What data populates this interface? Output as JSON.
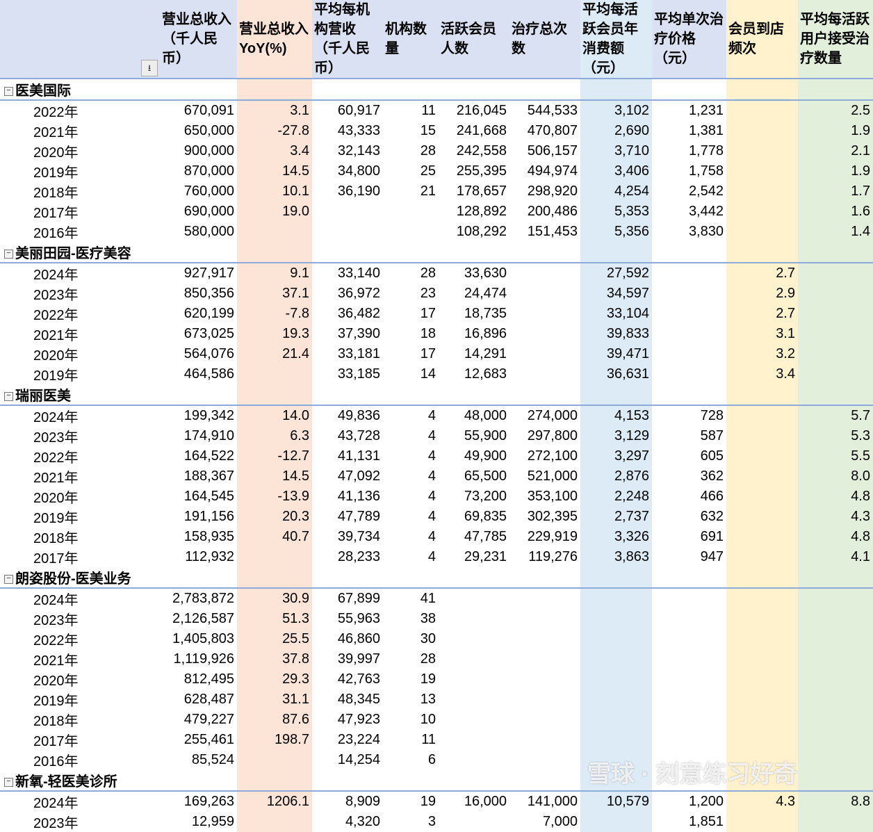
{
  "headers": [
    "",
    "营业总收入（千人民币）",
    "营业总收入YoY(%)",
    "平均每机构营收（千人民币）",
    "机构数量",
    "活跃会员人数",
    "治疗总次数",
    "平均每活跃会员年消费额（元）",
    "平均单次治疗价格（元）",
    "会员到店频次",
    "平均每活跃用户接受治疗数量"
  ],
  "filter_icon": "sort-filter-icon",
  "collapse_symbol": "−",
  "watermark": "雪球 · 刻意练习好奇",
  "groups": [
    {
      "name": "医美国际",
      "rows": [
        [
          "2022年",
          "670,091",
          "3.1",
          "60,917",
          "11",
          "216,045",
          "544,533",
          "3,102",
          "1,231",
          "",
          "2.5"
        ],
        [
          "2021年",
          "650,000",
          "-27.8",
          "43,333",
          "15",
          "241,668",
          "470,807",
          "2,690",
          "1,381",
          "",
          "1.9"
        ],
        [
          "2020年",
          "900,000",
          "3.4",
          "32,143",
          "28",
          "242,558",
          "506,157",
          "3,710",
          "1,778",
          "",
          "2.1"
        ],
        [
          "2019年",
          "870,000",
          "14.5",
          "34,800",
          "25",
          "255,395",
          "494,974",
          "3,406",
          "1,758",
          "",
          "1.9"
        ],
        [
          "2018年",
          "760,000",
          "10.1",
          "36,190",
          "21",
          "178,657",
          "298,920",
          "4,254",
          "2,542",
          "",
          "1.7"
        ],
        [
          "2017年",
          "690,000",
          "19.0",
          "",
          "",
          "128,892",
          "200,486",
          "5,353",
          "3,442",
          "",
          "1.6"
        ],
        [
          "2016年",
          "580,000",
          "",
          "",
          "",
          "108,292",
          "151,453",
          "5,356",
          "3,830",
          "",
          "1.4"
        ]
      ]
    },
    {
      "name": "美丽田园-医疗美容",
      "rows": [
        [
          "2024年",
          "927,917",
          "9.1",
          "33,140",
          "28",
          "33,630",
          "",
          "27,592",
          "",
          "2.7",
          ""
        ],
        [
          "2023年",
          "850,356",
          "37.1",
          "36,972",
          "23",
          "24,474",
          "",
          "34,597",
          "",
          "2.9",
          ""
        ],
        [
          "2022年",
          "620,199",
          "-7.8",
          "36,482",
          "17",
          "18,735",
          "",
          "33,104",
          "",
          "2.7",
          ""
        ],
        [
          "2021年",
          "673,025",
          "19.3",
          "37,390",
          "18",
          "16,896",
          "",
          "39,833",
          "",
          "3.1",
          ""
        ],
        [
          "2020年",
          "564,076",
          "21.4",
          "33,181",
          "17",
          "14,291",
          "",
          "39,471",
          "",
          "3.2",
          ""
        ],
        [
          "2019年",
          "464,586",
          "",
          "33,185",
          "14",
          "12,683",
          "",
          "36,631",
          "",
          "3.4",
          ""
        ]
      ]
    },
    {
      "name": "瑞丽医美",
      "rows": [
        [
          "2024年",
          "199,342",
          "14.0",
          "49,836",
          "4",
          "48,000",
          "274,000",
          "4,153",
          "728",
          "",
          "5.7"
        ],
        [
          "2023年",
          "174,910",
          "6.3",
          "43,728",
          "4",
          "55,900",
          "297,800",
          "3,129",
          "587",
          "",
          "5.3"
        ],
        [
          "2022年",
          "164,522",
          "-12.7",
          "41,131",
          "4",
          "49,900",
          "272,100",
          "3,297",
          "605",
          "",
          "5.5"
        ],
        [
          "2021年",
          "188,367",
          "14.5",
          "47,092",
          "4",
          "65,500",
          "521,000",
          "2,876",
          "362",
          "",
          "8.0"
        ],
        [
          "2020年",
          "164,545",
          "-13.9",
          "41,136",
          "4",
          "73,200",
          "353,100",
          "2,248",
          "466",
          "",
          "4.8"
        ],
        [
          "2019年",
          "191,156",
          "20.3",
          "47,789",
          "4",
          "69,835",
          "302,395",
          "2,737",
          "632",
          "",
          "4.3"
        ],
        [
          "2018年",
          "158,935",
          "40.7",
          "39,734",
          "4",
          "47,785",
          "229,919",
          "3,326",
          "691",
          "",
          "4.8"
        ],
        [
          "2017年",
          "112,932",
          "",
          "28,233",
          "4",
          "29,231",
          "119,276",
          "3,863",
          "947",
          "",
          "4.1"
        ]
      ]
    },
    {
      "name": "朗姿股份-医美业务",
      "rows": [
        [
          "2024年",
          "2,783,872",
          "30.9",
          "67,899",
          "41",
          "",
          "",
          "",
          "",
          "",
          ""
        ],
        [
          "2023年",
          "2,126,587",
          "51.3",
          "55,963",
          "38",
          "",
          "",
          "",
          "",
          "",
          ""
        ],
        [
          "2022年",
          "1,405,803",
          "25.5",
          "46,860",
          "30",
          "",
          "",
          "",
          "",
          "",
          ""
        ],
        [
          "2021年",
          "1,119,926",
          "37.8",
          "39,997",
          "28",
          "",
          "",
          "",
          "",
          "",
          ""
        ],
        [
          "2020年",
          "812,495",
          "29.3",
          "42,763",
          "19",
          "",
          "",
          "",
          "",
          "",
          ""
        ],
        [
          "2019年",
          "628,487",
          "31.1",
          "48,345",
          "13",
          "",
          "",
          "",
          "",
          "",
          ""
        ],
        [
          "2018年",
          "479,227",
          "87.6",
          "47,923",
          "10",
          "",
          "",
          "",
          "",
          "",
          ""
        ],
        [
          "2017年",
          "255,461",
          "198.7",
          "23,224",
          "11",
          "",
          "",
          "",
          "",
          "",
          ""
        ],
        [
          "2016年",
          "85,524",
          "",
          "14,254",
          "6",
          "",
          "",
          "",
          "",
          "",
          ""
        ]
      ]
    },
    {
      "name": "新氧-轻医美诊所",
      "rows": [
        [
          "2024年",
          "169,263",
          "1206.1",
          "8,909",
          "19",
          "16,000",
          "141,000",
          "10,579",
          "1,200",
          "4.3",
          "8.8"
        ],
        [
          "2023年",
          "12,959",
          "",
          "4,320",
          "3",
          "",
          "7,000",
          "",
          "1,851",
          "",
          ""
        ]
      ]
    }
  ]
}
